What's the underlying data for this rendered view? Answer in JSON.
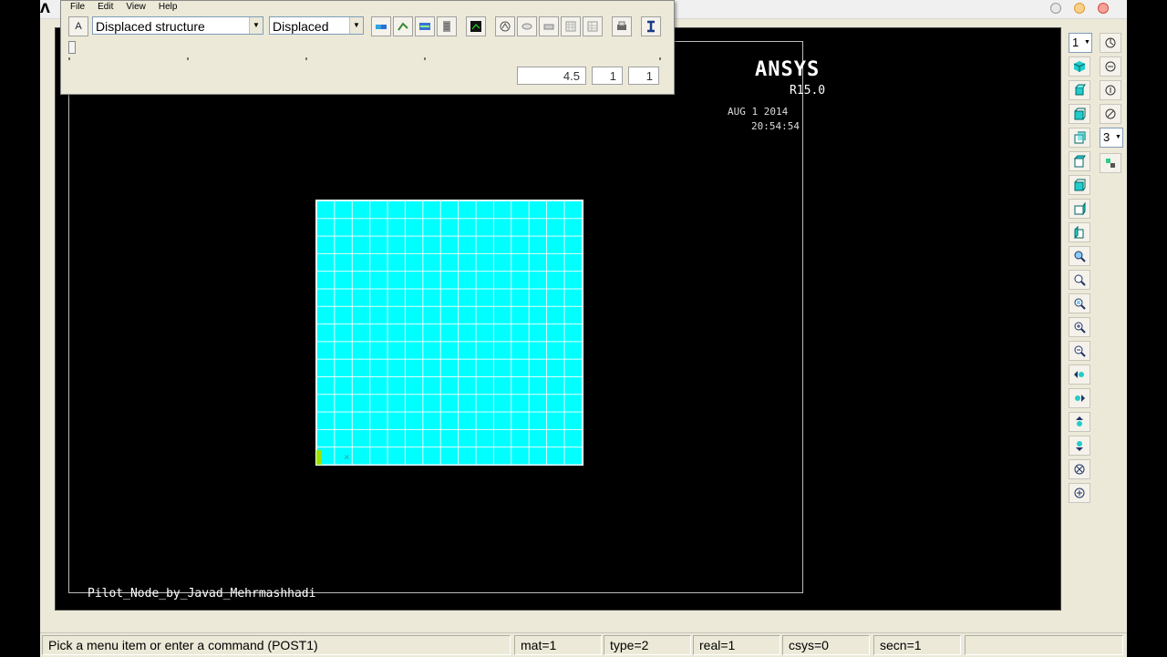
{
  "graphics": {
    "ansys_title": "ANSYS",
    "ansys_release": "R15.0",
    "date": "AUG  1 2014",
    "time": "20:54:54",
    "caption": "Pilot_Node_by_Javad_Mehrmashhadi",
    "mesh_color": "#00ffff"
  },
  "toolbar": {
    "menu": [
      "File",
      "Edit",
      "View",
      "Help"
    ],
    "result_combo": "Displaced structure",
    "mode_combo": "Displaced",
    "value_field": "4.5",
    "field2": "1",
    "field3": "1"
  },
  "right_panel": {
    "window_select": "1",
    "view_select": "3"
  },
  "status": {
    "prompt": "Pick a menu item or enter a command (POST1)",
    "mat": "mat=1",
    "type": "type=2",
    "real": "real=1",
    "csys": "csys=0",
    "secn": "secn=1"
  }
}
